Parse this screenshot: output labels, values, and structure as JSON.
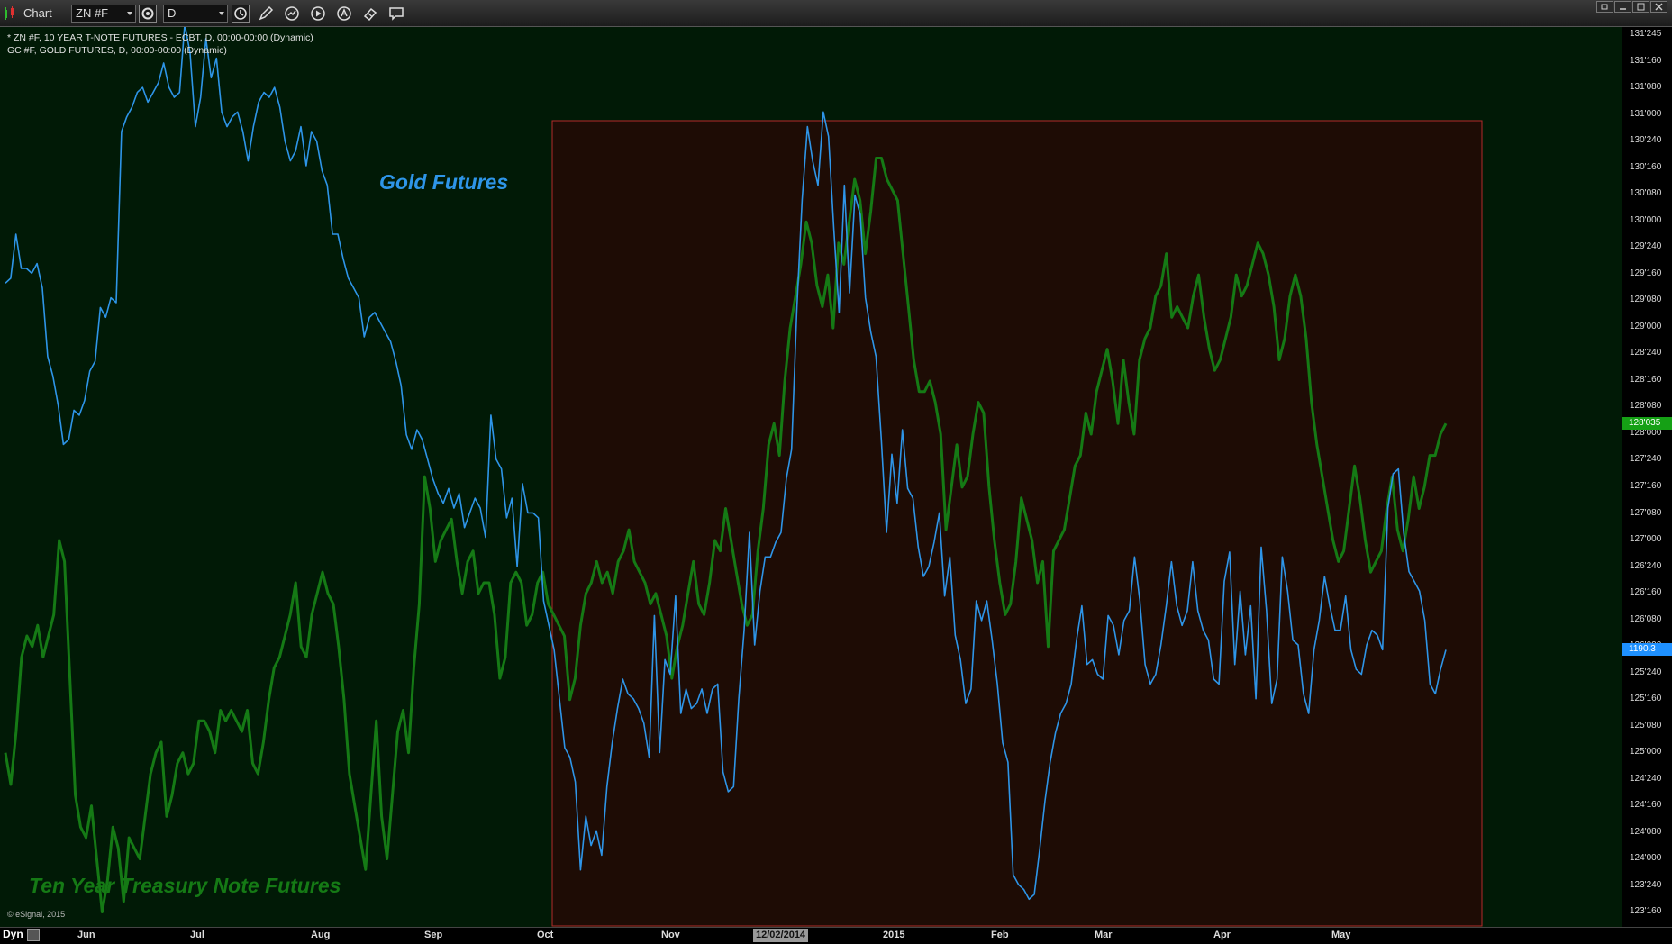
{
  "app": {
    "title": "Chart",
    "symbol_value": "ZN #F",
    "interval_value": "D"
  },
  "toolbar_icons": [
    "settings-icon",
    "clock-icon",
    "pencil-icon",
    "chart-style-icon",
    "play-icon",
    "alert-icon",
    "eraser-icon",
    "comment-icon"
  ],
  "window_controls": [
    "restore-icon",
    "minimize-icon",
    "maximize-icon",
    "close-icon"
  ],
  "chart_info": {
    "line1": "* ZN #F, 10 YEAR T-NOTE FUTURES - ECBT, D, 00:00-00:00 (Dynamic)",
    "line2": "GC #F, GOLD FUTURES, D, 00:00-00:00 (Dynamic)"
  },
  "labels": {
    "gold": "Gold Futures",
    "tnote": "Ten Year Treasury Note Futures",
    "copyright": "© eSignal, 2015",
    "dyn": "Dyn"
  },
  "colors": {
    "gold_line": "#2e95e8",
    "tnote_line": "#157a15",
    "plot_bg": "#011a06",
    "highlight_bg": "#1e0c05",
    "highlight_border": "#b32a2a",
    "current_tnote_badge": "#15a015",
    "current_gold_badge": "#1e90ff"
  },
  "chart_data": {
    "type": "line",
    "price_axis_labels": [
      "131'245",
      "131'160",
      "131'080",
      "131'000",
      "130'240",
      "130'160",
      "130'080",
      "130'000",
      "129'240",
      "129'160",
      "129'080",
      "129'000",
      "128'240",
      "128'160",
      "128'080",
      "128'000",
      "127'240",
      "127'160",
      "127'080",
      "127'000",
      "126'240",
      "126'160",
      "126'080",
      "126'000",
      "125'240",
      "125'160",
      "125'080",
      "125'000",
      "124'240",
      "124'160",
      "124'080",
      "124'000",
      "123'240",
      "123'160"
    ],
    "time_axis_labels": [
      "Jun",
      "Jul",
      "Aug",
      "Sep",
      "Oct",
      "Nov",
      "12/02/2014",
      "2015",
      "Feb",
      "Mar",
      "Apr",
      "May"
    ],
    "highlighted_date": "12/02/2014",
    "highlight_range": {
      "from": "Oct",
      "to": "late May"
    },
    "current_values": {
      "tnote": "128'035",
      "gold": "1190.3"
    },
    "series": [
      {
        "name": "Ten Year Treasury Note Futures",
        "unit": "price (32nds)",
        "values": [
          125.0,
          124.7,
          125.2,
          125.9,
          126.1,
          126.0,
          126.2,
          125.9,
          126.1,
          126.3,
          127.0,
          126.8,
          125.7,
          124.6,
          124.3,
          124.2,
          124.5,
          124.0,
          123.5,
          123.8,
          124.3,
          124.1,
          123.6,
          124.2,
          124.1,
          124.0,
          124.4,
          124.8,
          125.0,
          125.1,
          124.4,
          124.6,
          124.9,
          125.0,
          124.8,
          124.9,
          125.3,
          125.3,
          125.2,
          125.0,
          125.4,
          125.3,
          125.4,
          125.3,
          125.2,
          125.4,
          124.9,
          124.8,
          125.1,
          125.5,
          125.8,
          125.9,
          126.1,
          126.3,
          126.6,
          126.0,
          125.9,
          126.3,
          126.5,
          126.7,
          126.5,
          126.4,
          126.0,
          125.5,
          124.8,
          124.5,
          124.2,
          123.9,
          124.6,
          125.3,
          124.4,
          124.0,
          124.6,
          125.2,
          125.4,
          125.0,
          125.8,
          126.4,
          127.6,
          127.3,
          126.8,
          127.0,
          127.1,
          127.2,
          126.8,
          126.5,
          126.8,
          126.9,
          126.5,
          126.6,
          126.6,
          126.3,
          125.7,
          125.9,
          126.6,
          126.7,
          126.6,
          126.2,
          126.3,
          126.6,
          126.7,
          126.4,
          126.3,
          126.2,
          126.1,
          125.5,
          125.7,
          126.2,
          126.5,
          126.6,
          126.8,
          126.6,
          126.7,
          126.5,
          126.8,
          126.9,
          127.1,
          126.8,
          126.7,
          126.6,
          126.4,
          126.5,
          126.3,
          126.1,
          125.7,
          126.0,
          126.2,
          126.5,
          126.8,
          126.4,
          126.3,
          126.6,
          127.0,
          126.9,
          127.3,
          127.0,
          126.7,
          126.4,
          126.2,
          126.3,
          126.9,
          127.3,
          127.9,
          128.1,
          127.8,
          128.5,
          129.0,
          129.3,
          129.6,
          130.0,
          129.8,
          129.4,
          129.2,
          129.5,
          129.0,
          129.8,
          129.6,
          130.0,
          130.4,
          130.2,
          129.7,
          130.1,
          130.6,
          130.6,
          130.4,
          130.3,
          130.2,
          129.7,
          129.2,
          128.7,
          128.4,
          128.4,
          128.5,
          128.3,
          128.0,
          127.1,
          127.5,
          127.9,
          127.5,
          127.6,
          128.0,
          128.3,
          128.2,
          127.5,
          127.0,
          126.6,
          126.3,
          126.4,
          126.8,
          127.4,
          127.2,
          127.0,
          126.6,
          126.8,
          126.0,
          126.9,
          127.0,
          127.1,
          127.4,
          127.7,
          127.8,
          128.2,
          128.0,
          128.4,
          128.6,
          128.8,
          128.5,
          128.1,
          128.7,
          128.3,
          128.0,
          128.7,
          128.9,
          129.0,
          129.3,
          129.4,
          129.7,
          129.1,
          129.2,
          129.1,
          129.0,
          129.3,
          129.5,
          129.1,
          128.8,
          128.6,
          128.7,
          128.9,
          129.1,
          129.5,
          129.3,
          129.4,
          129.6,
          129.8,
          129.7,
          129.5,
          129.2,
          128.7,
          128.9,
          129.3,
          129.5,
          129.3,
          128.9,
          128.3,
          127.9,
          127.6,
          127.3,
          127.0,
          126.8,
          126.9,
          127.3,
          127.7,
          127.4,
          127.0,
          126.7,
          126.8,
          126.9,
          127.3,
          127.6,
          127.1,
          126.9,
          127.2,
          127.6,
          127.3,
          127.5,
          127.8,
          127.8,
          128.0,
          128.1
        ]
      },
      {
        "name": "Gold Futures",
        "unit": "USD/oz",
        "values": [
          1265,
          1266,
          1275,
          1268,
          1268,
          1267,
          1269,
          1264,
          1250,
          1246,
          1240,
          1232,
          1233,
          1239,
          1238,
          1241,
          1247,
          1249,
          1260,
          1258,
          1262,
          1261,
          1296,
          1299,
          1301,
          1304,
          1305,
          1302,
          1304,
          1306,
          1310,
          1305,
          1303,
          1304,
          1318,
          1312,
          1297,
          1303,
          1315,
          1307,
          1311,
          1300,
          1297,
          1299,
          1300,
          1296,
          1290,
          1297,
          1302,
          1304,
          1303,
          1305,
          1301,
          1294,
          1290,
          1292,
          1297,
          1289,
          1296,
          1294,
          1288,
          1285,
          1275,
          1275,
          1270,
          1266,
          1264,
          1262,
          1254,
          1258,
          1259,
          1257,
          1255,
          1253,
          1249,
          1244,
          1234,
          1231,
          1235,
          1233,
          1229,
          1225,
          1222,
          1220,
          1223,
          1219,
          1222,
          1215,
          1218,
          1221,
          1219,
          1213,
          1238,
          1229,
          1227,
          1217,
          1221,
          1207,
          1224,
          1218,
          1218,
          1217,
          1200,
          1195,
          1190,
          1180,
          1170,
          1168,
          1163,
          1145,
          1156,
          1150,
          1153,
          1148,
          1162,
          1171,
          1178,
          1184,
          1181,
          1180,
          1178,
          1175,
          1168,
          1197,
          1169,
          1188,
          1185,
          1201,
          1177,
          1182,
          1178,
          1179,
          1182,
          1177,
          1182,
          1183,
          1165,
          1161,
          1162,
          1180,
          1194,
          1214,
          1191,
          1202,
          1209,
          1209,
          1212,
          1214,
          1225,
          1231,
          1260,
          1282,
          1297,
          1290,
          1285,
          1300,
          1295,
          1276,
          1259,
          1285,
          1263,
          1283,
          1279,
          1262,
          1255,
          1250,
          1233,
          1214,
          1230,
          1220,
          1235,
          1223,
          1221,
          1211,
          1205,
          1207,
          1212,
          1218,
          1201,
          1209,
          1193,
          1188,
          1179,
          1182,
          1200,
          1196,
          1200,
          1192,
          1183,
          1171,
          1167,
          1144,
          1142,
          1141,
          1139,
          1140,
          1149,
          1159,
          1167,
          1173,
          1177,
          1179,
          1183,
          1192,
          1199,
          1187,
          1188,
          1185,
          1184,
          1197,
          1195,
          1189,
          1196,
          1198,
          1209,
          1200,
          1187,
          1183,
          1185,
          1191,
          1199,
          1208,
          1199,
          1195,
          1198,
          1208,
          1198,
          1194,
          1192,
          1184,
          1183,
          1204,
          1210,
          1187,
          1202,
          1189,
          1199,
          1180,
          1211,
          1198,
          1179,
          1184,
          1209,
          1202,
          1192,
          1191,
          1181,
          1177,
          1190,
          1196,
          1205,
          1199,
          1194,
          1194,
          1201,
          1190,
          1186,
          1185,
          1191,
          1194,
          1193,
          1190,
          1219,
          1226,
          1227,
          1214,
          1206,
          1204,
          1202,
          1196,
          1183,
          1181,
          1186,
          1190
        ]
      }
    ]
  }
}
